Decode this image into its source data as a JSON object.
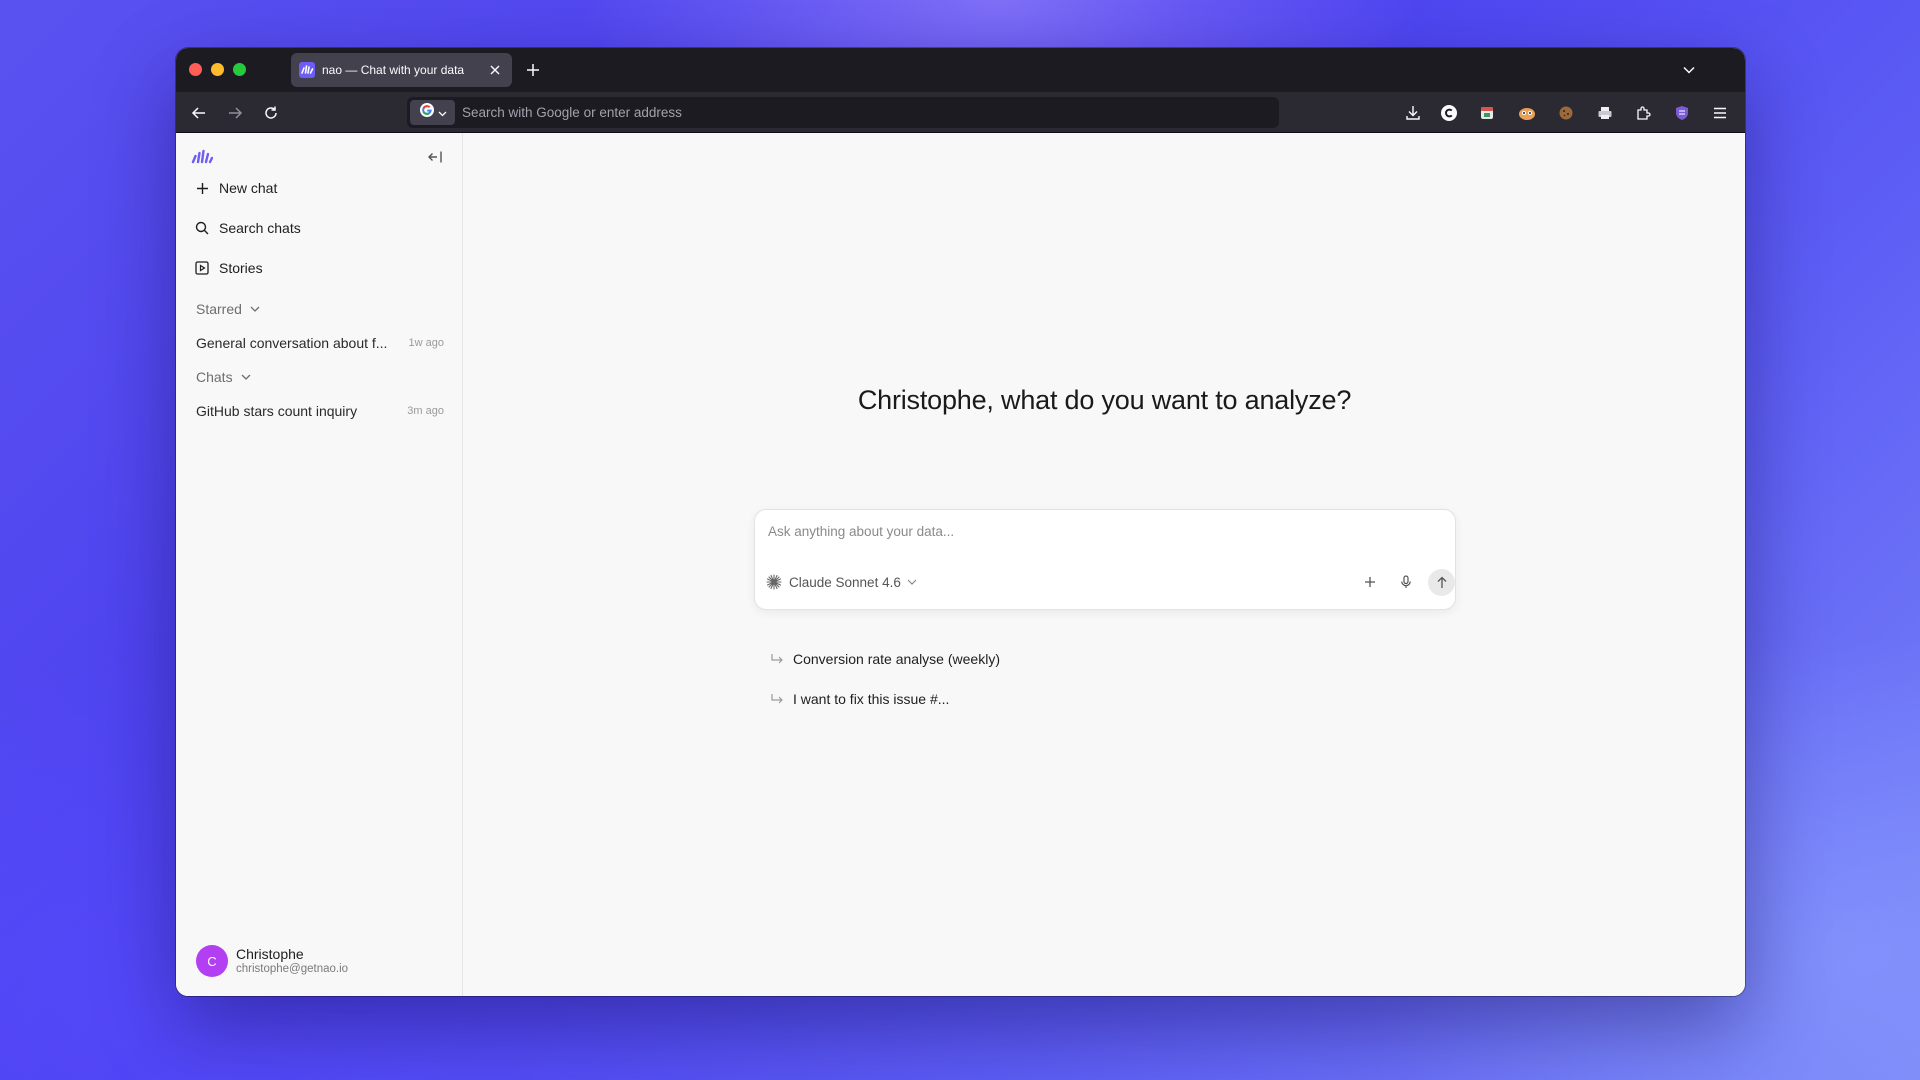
{
  "browser": {
    "tab_title": "nao — Chat with your data",
    "url_placeholder": "Search with Google or enter address"
  },
  "sidebar": {
    "items": [
      {
        "label": "New chat",
        "icon": "plus-icon"
      },
      {
        "label": "Search chats",
        "icon": "search-icon"
      },
      {
        "label": "Stories",
        "icon": "stories-icon"
      }
    ],
    "starred_label": "Starred",
    "starred": [
      {
        "label": "General conversation about f...",
        "time": "1w ago"
      }
    ],
    "chats_label": "Chats",
    "chats": [
      {
        "label": "GitHub stars count inquiry",
        "time": "3m ago"
      }
    ],
    "user": {
      "initial": "C",
      "name": "Christophe",
      "email": "christophe@getnao.io"
    }
  },
  "main": {
    "headline": "Christophe, what do you want to analyze?",
    "composer_placeholder": "Ask anything about your data...",
    "model_name": "Claude Sonnet 4.6",
    "suggestions": [
      {
        "label": "Conversion rate analyse (weekly)"
      },
      {
        "label": "I want to fix this issue #..."
      }
    ]
  },
  "colors": {
    "accent": "#5b4df0",
    "avatar": "#b23ff2"
  }
}
